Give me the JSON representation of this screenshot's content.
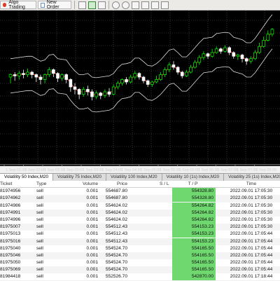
{
  "toolbar": {
    "algo_trading_label": "Algo Trading",
    "new_order_label": "New Order"
  },
  "chart": {
    "x_axis_labels": [
      "1 Sep 01:30",
      "1 Sep 02:00",
      "1 Sep 02:30",
      "1 Sep 03:00",
      "1 Sep 03:30",
      "1 Sep 04:00",
      "1 Sep 04:30",
      "1 Sep 05:00",
      "1 Sep 05:30",
      "1 Sep 06:00",
      "1 Sep 06:30",
      "1 Sep 07:00",
      "1 Sep 07:30",
      "1 Sep 08:00"
    ],
    "candle_up_color": "#00ff00",
    "candle_down_color": "#ffffff",
    "band_color": "#e0e0e0",
    "ma_color": "#ff2a2a",
    "grid_color": "#5a5a5a",
    "candles": [
      [
        60,
        62,
        63,
        55
      ],
      [
        62,
        61,
        64,
        57
      ],
      [
        61,
        63,
        65,
        58
      ],
      [
        63,
        62,
        66,
        59
      ],
      [
        62,
        64,
        67,
        60
      ],
      [
        64,
        62,
        65,
        59
      ],
      [
        62,
        60,
        63,
        56
      ],
      [
        60,
        58,
        62,
        54
      ],
      [
        58,
        62,
        63,
        55
      ],
      [
        62,
        66,
        68,
        60
      ],
      [
        66,
        63,
        67,
        60
      ],
      [
        63,
        59,
        64,
        56
      ],
      [
        59,
        62,
        63,
        57
      ],
      [
        62,
        58,
        63,
        55
      ],
      [
        58,
        52,
        59,
        48
      ],
      [
        52,
        50,
        55,
        46
      ],
      [
        50,
        46,
        51,
        42
      ],
      [
        46,
        50,
        52,
        44
      ],
      [
        50,
        48,
        53,
        45
      ],
      [
        48,
        44,
        50,
        41
      ],
      [
        44,
        47,
        49,
        42
      ],
      [
        47,
        45,
        48,
        42
      ],
      [
        45,
        48,
        50,
        43
      ],
      [
        48,
        46,
        51,
        44
      ],
      [
        46,
        52,
        54,
        45
      ],
      [
        52,
        55,
        57,
        50
      ],
      [
        55,
        58,
        59,
        53
      ],
      [
        58,
        56,
        60,
        54
      ],
      [
        56,
        60,
        62,
        55
      ],
      [
        60,
        63,
        65,
        58
      ],
      [
        63,
        60,
        64,
        58
      ],
      [
        60,
        57,
        61,
        55
      ],
      [
        57,
        54,
        58,
        52
      ],
      [
        54,
        56,
        57,
        52
      ],
      [
        56,
        58,
        61,
        55
      ],
      [
        58,
        62,
        64,
        57
      ],
      [
        62,
        66,
        68,
        60
      ],
      [
        66,
        70,
        72,
        64
      ],
      [
        70,
        68,
        73,
        66
      ],
      [
        68,
        64,
        69,
        62
      ],
      [
        64,
        61,
        65,
        59
      ],
      [
        61,
        64,
        66,
        60
      ],
      [
        64,
        68,
        70,
        63
      ],
      [
        68,
        72,
        74,
        67
      ],
      [
        72,
        76,
        78,
        70
      ],
      [
        76,
        79,
        81,
        74
      ],
      [
        79,
        77,
        80,
        75
      ],
      [
        77,
        80,
        83,
        76
      ],
      [
        80,
        83,
        85,
        79
      ],
      [
        83,
        81,
        84,
        79
      ],
      [
        81,
        84,
        86,
        80
      ],
      [
        84,
        80,
        85,
        78
      ],
      [
        80,
        77,
        81,
        75
      ],
      [
        77,
        78,
        79,
        74
      ],
      [
        78,
        75,
        79,
        72
      ],
      [
        75,
        73,
        76,
        70
      ],
      [
        73,
        75,
        77,
        71
      ],
      [
        75,
        80,
        82,
        74
      ],
      [
        80,
        85,
        88,
        79
      ],
      [
        85,
        90,
        93,
        84
      ],
      [
        90,
        95,
        98,
        89
      ],
      [
        95,
        99,
        100,
        93
      ]
    ]
  },
  "tabs": [
    {
      "label": "Volatility 50 Index,M20",
      "active": true
    },
    {
      "label": "Volatility 75 Index,M20",
      "active": false
    },
    {
      "label": "Volatility 100 Index,M20",
      "active": false
    },
    {
      "label": "Volatility 10 (1s) Index,M20",
      "active": false
    },
    {
      "label": "Volatility 25 (1s) Index,M20",
      "active": false
    }
  ],
  "table": {
    "headers": {
      "ticket": "Ticket",
      "type": "Type",
      "volume": "Volume",
      "price": "Price",
      "sl": "S / L",
      "tp": "T / P",
      "time": "Time"
    },
    "rows": [
      {
        "ticket": "81974956",
        "type": "sell",
        "volume": "0.001",
        "price": "554687.80",
        "sl": "",
        "tp": "554328.80",
        "time": "2022.09.01 17:05:30"
      },
      {
        "ticket": "81974962",
        "type": "sell",
        "volume": "0.001",
        "price": "554687.80",
        "sl": "",
        "tp": "554328.80",
        "time": "2022.09.01 17:05:30"
      },
      {
        "ticket": "81974986",
        "type": "sell",
        "volume": "0.001",
        "price": "554624.02",
        "sl": "",
        "tp": "554264.82",
        "time": "2022.09.01 17:05:30"
      },
      {
        "ticket": "81974991",
        "type": "sell",
        "volume": "0.001",
        "price": "554624.02",
        "sl": "",
        "tp": "554264.82",
        "time": "2022.09.01 17:05:30"
      },
      {
        "ticket": "81974996",
        "type": "sell",
        "volume": "0.001",
        "price": "554624.02",
        "sl": "",
        "tp": "554264.82",
        "time": "2022.09.01 17:05:30"
      },
      {
        "ticket": "81975007",
        "type": "sell",
        "volume": "0.001",
        "price": "554512.43",
        "sl": "",
        "tp": "554153.23",
        "time": "2022.09.01 17:05:30"
      },
      {
        "ticket": "81975013",
        "type": "sell",
        "volume": "0.001",
        "price": "554512.43",
        "sl": "",
        "tp": "554153.23",
        "time": "2022.09.01 17:05:44"
      },
      {
        "ticket": "81975016",
        "type": "sell",
        "volume": "0.001",
        "price": "554512.43",
        "sl": "",
        "tp": "554153.23",
        "time": "2022.09.01 17:05:44"
      },
      {
        "ticket": "81975040",
        "type": "sell",
        "volume": "0.001",
        "price": "554524.70",
        "sl": "",
        "tp": "554165.50",
        "time": "2022.09.01 17:05:44"
      },
      {
        "ticket": "81975046",
        "type": "sell",
        "volume": "0.001",
        "price": "554524.70",
        "sl": "",
        "tp": "554165.50",
        "time": "2022.09.01 17:05:44"
      },
      {
        "ticket": "81975050",
        "type": "sell",
        "volume": "0.001",
        "price": "554524.70",
        "sl": "",
        "tp": "554165.50",
        "time": "2022.09.01 17:05:44"
      },
      {
        "ticket": "81975069",
        "type": "sell",
        "volume": "0.001",
        "price": "554524.70",
        "sl": "",
        "tp": "554165.50",
        "time": "2022.09.01 17:05:44"
      },
      {
        "ticket": "81984418",
        "type": "sell",
        "volume": "0.001",
        "price": "552526.70",
        "sl": "",
        "tp": "542870.00",
        "time": "2022.09.01 17:18:44"
      }
    ]
  }
}
